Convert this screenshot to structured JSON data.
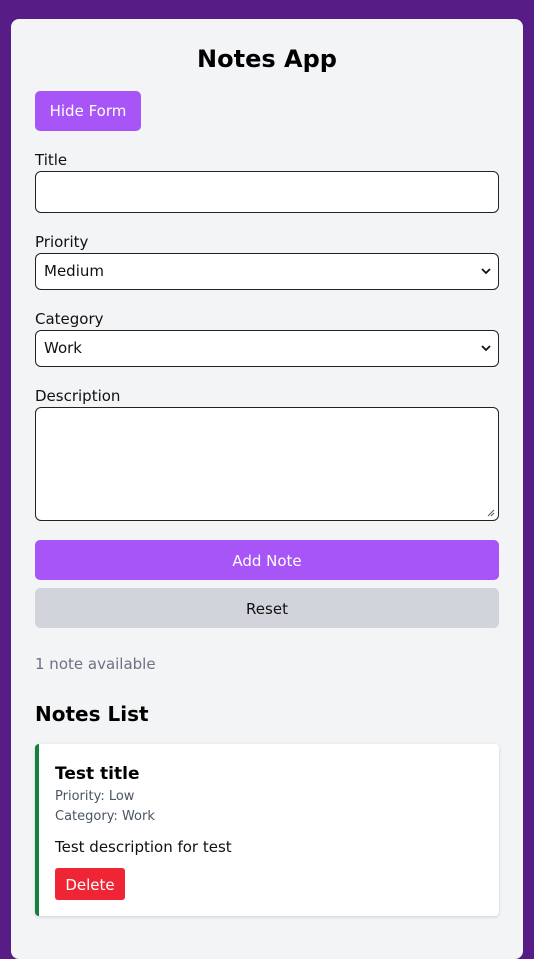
{
  "app": {
    "title": "Notes App",
    "toggle_form_label": "Hide Form"
  },
  "form": {
    "title_label": "Title",
    "title_value": "",
    "priority_label": "Priority",
    "priority_value": "Medium",
    "category_label": "Category",
    "category_value": "Work",
    "description_label": "Description",
    "description_value": "",
    "add_label": "Add Note",
    "reset_label": "Reset"
  },
  "status": {
    "count_text": "1 note available"
  },
  "list": {
    "title": "Notes List",
    "notes": [
      {
        "title": "Test title",
        "priority": "Priority: Low",
        "category": "Category: Work",
        "description": "Test description for test",
        "delete_label": "Delete"
      }
    ]
  },
  "colors": {
    "background": "#581c87",
    "accent": "#a855f7",
    "reset": "#d1d5db",
    "delete": "#ef2535",
    "note_border": "#15803d"
  },
  "icons": {
    "select_arrow": "chevron-down-icon",
    "resize": "resize-grip-icon"
  }
}
